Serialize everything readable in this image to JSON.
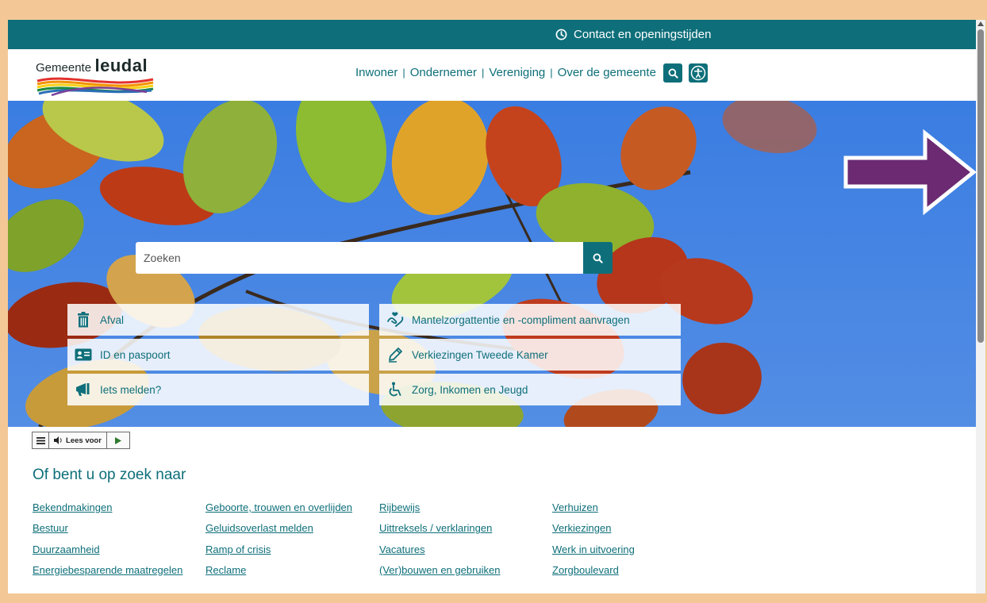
{
  "topbar": {
    "contact_label": "Contact en openingstijden"
  },
  "logo": {
    "prefix": "Gemeente",
    "name": "leudal"
  },
  "nav": {
    "items": [
      "Inwoner",
      "Ondernemer",
      "Vereniging",
      "Over de gemeente"
    ],
    "separator": "|"
  },
  "search": {
    "placeholder": "Zoeken"
  },
  "tiles": [
    {
      "label": "Afval",
      "icon": "trash-icon"
    },
    {
      "label": "Mantelzorgattentie en -compliment aanvragen",
      "icon": "caring-hands-icon"
    },
    {
      "label": "ID en paspoort",
      "icon": "id-card-icon"
    },
    {
      "label": "Verkiezingen Tweede Kamer",
      "icon": "pencil-icon"
    },
    {
      "label": "Iets melden?",
      "icon": "megaphone-icon"
    },
    {
      "label": "Zorg, Inkomen en Jeugd",
      "icon": "wheelchair-icon"
    }
  ],
  "readspeaker": {
    "label": "Lees voor"
  },
  "section_title": "Of bent u op zoek naar",
  "links": [
    [
      "Bekendmakingen",
      "Bestuur",
      "Duurzaamheid",
      "Energiebesparende maatregelen"
    ],
    [
      "Geboorte, trouwen en overlijden",
      "Geluidsoverlast melden",
      "Ramp of crisis",
      "Reclame"
    ],
    [
      "Rijbewijs",
      "Uittreksels / verklaringen",
      "Vacatures",
      "(Ver)bouwen en gebruiken"
    ],
    [
      "Verhuizen",
      "Verkiezingen",
      "Werk in uitvoering",
      "Zorgboulevard"
    ]
  ],
  "colors": {
    "teal": "#0e6f7a",
    "frame": "#f3c896",
    "arrow": "#6b2a72",
    "sky": "#3f7fe0"
  }
}
